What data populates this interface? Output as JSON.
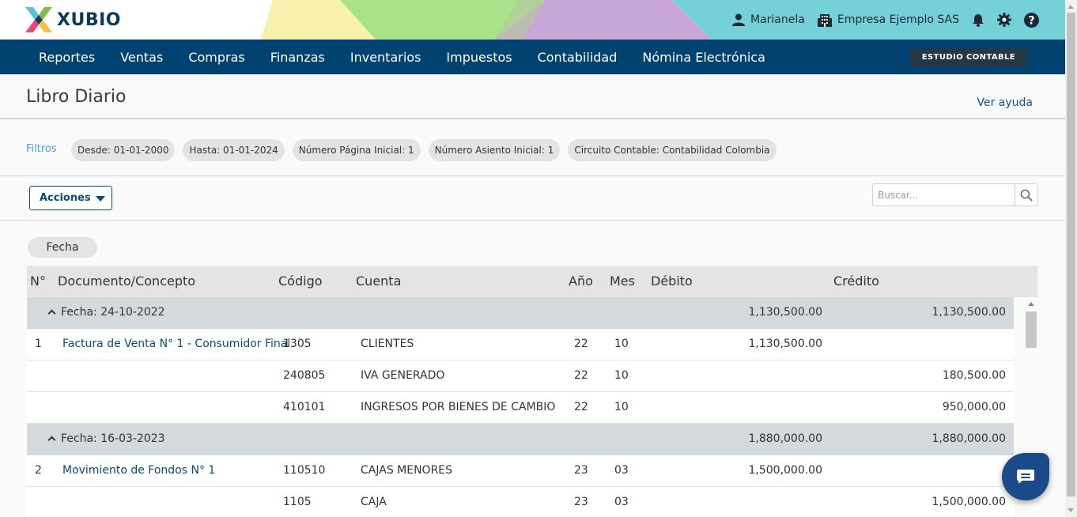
{
  "brand": {
    "name": "XUBIO"
  },
  "header": {
    "user_name": "Marianela",
    "company_name": "Empresa Ejemplo SAS"
  },
  "nav": {
    "items": [
      "Reportes",
      "Ventas",
      "Compras",
      "Finanzas",
      "Inventarios",
      "Impuestos",
      "Contabilidad",
      "Nómina Electrónica"
    ],
    "studio_button": "ESTUDIO CONTABLE"
  },
  "page": {
    "title": "Libro Diario",
    "help_link": "Ver ayuda"
  },
  "filters": {
    "label": "Filtros",
    "chips": [
      "Desde:  01-01-2000",
      "Hasta:  01-01-2024",
      "Número Página Inicial:  1",
      "Número Asiento Inicial:  1",
      "Circuito Contable:  Contabilidad Colombia"
    ]
  },
  "toolbar": {
    "actions_label": "Acciones",
    "search_placeholder": "Buscar..."
  },
  "sort": {
    "label": "Fecha"
  },
  "table": {
    "headers": {
      "num": "N°",
      "doc": "Documento/Concepto",
      "code": "Código",
      "account": "Cuenta",
      "year": "Año",
      "month": "Mes",
      "debit": "Débito",
      "credit": "Crédito"
    },
    "rows": [
      {
        "type": "group",
        "label": "Fecha: 24-10-2022",
        "debit": "1,130,500.00",
        "credit": "1,130,500.00"
      },
      {
        "type": "entry",
        "num": "1",
        "doc": "Factura de Venta N° 1 - Consumidor Final",
        "code": "1305",
        "account": "CLIENTES",
        "year": "22",
        "month": "10",
        "debit": "1,130,500.00",
        "credit": ""
      },
      {
        "type": "entry",
        "num": "",
        "doc": "",
        "code": "240805",
        "account": "IVA GENERADO",
        "year": "22",
        "month": "10",
        "debit": "",
        "credit": "180,500.00"
      },
      {
        "type": "entry",
        "num": "",
        "doc": "",
        "code": "410101",
        "account": "INGRESOS POR BIENES DE CAMBIO",
        "year": "22",
        "month": "10",
        "debit": "",
        "credit": "950,000.00"
      },
      {
        "type": "group",
        "label": "Fecha: 16-03-2023",
        "debit": "1,880,000.00",
        "credit": "1,880,000.00"
      },
      {
        "type": "entry",
        "num": "2",
        "doc": "Movimiento de Fondos N° 1",
        "code": "110510",
        "account": "CAJAS MENORES",
        "year": "23",
        "month": "03",
        "debit": "1,500,000.00",
        "credit": ""
      },
      {
        "type": "entry",
        "num": "",
        "doc": "",
        "code": "1105",
        "account": "CAJA",
        "year": "23",
        "month": "03",
        "debit": "",
        "credit": "1,500,000.00"
      }
    ]
  },
  "colors": {
    "nav_bg": "#004370",
    "link": "#0b4a78",
    "filters_label": "#4aa3df",
    "group_row": "#d3d9dd",
    "chat_button": "#1a4a87"
  },
  "icons": [
    "user-icon",
    "building-icon",
    "bell-icon",
    "gear-icon",
    "help-icon",
    "search-icon",
    "chevron-up-icon",
    "chat-icon"
  ]
}
